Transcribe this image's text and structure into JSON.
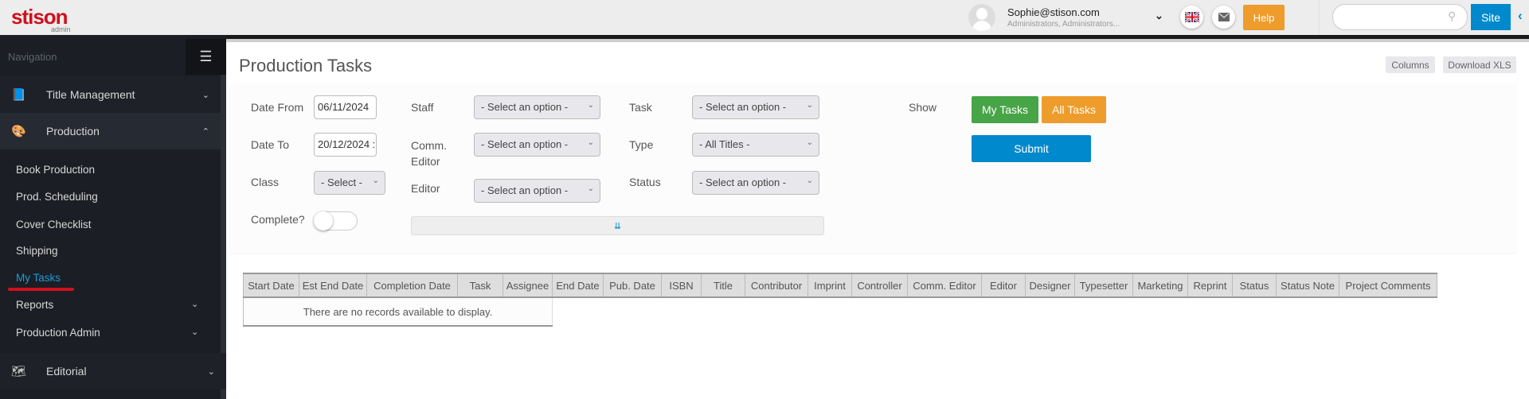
{
  "brand": {
    "logo": "stison",
    "sub": "admin",
    "color": "#d0101e"
  },
  "topbar": {
    "user_email": "Sophie@stison.com",
    "user_roles": "Administrators, Administrators...",
    "help": "Help",
    "search_placeholder": "",
    "site": "Site"
  },
  "sidebar": {
    "heading": "Navigation",
    "sections": [
      {
        "label": "Title Management",
        "icon": "book-icon"
      },
      {
        "label": "Production",
        "icon": "palette-icon"
      },
      {
        "label": "Editorial",
        "icon": "map-icon"
      }
    ],
    "production_items": [
      "Book Production",
      "Prod. Scheduling",
      "Cover Checklist",
      "Shipping",
      "My Tasks"
    ],
    "active": "My Tasks",
    "production_groups": [
      "Reports",
      "Production Admin"
    ]
  },
  "page": {
    "title": "Production Tasks",
    "columns_btn": "Columns",
    "download_btn": "Download XLS"
  },
  "filters": {
    "date_from_label": "Date From",
    "date_from": "06/11/2024",
    "date_to_label": "Date To",
    "date_to": "20/12/2024 :",
    "class_label": "Class",
    "class_value": "- Select -",
    "complete_label": "Complete?",
    "complete": false,
    "staff_label": "Staff",
    "staff_value": "- Select an option -",
    "comm_editor_label": "Comm. Editor",
    "comm_editor_value": "- Select an option -",
    "editor_label": "Editor",
    "editor_value": "- Select an option -",
    "task_label": "Task",
    "task_value": "- Select an option -",
    "type_label": "Type",
    "type_value": "- All Titles -",
    "status_label": "Status",
    "status_value": "- Select an option -",
    "show_label": "Show",
    "my_tasks": "My Tasks",
    "all_tasks": "All Tasks",
    "submit": "Submit"
  },
  "colors": {
    "green": "#47a447",
    "orange": "#ee9c2b",
    "blue": "#0089cc",
    "active_link": "#1e9ad6",
    "underline": "#d0101e"
  },
  "table": {
    "columns": [
      "Start Date",
      "Est End Date",
      "Completion Date",
      "Task",
      "Assignee",
      "End Date",
      "Pub. Date",
      "ISBN",
      "Title",
      "Contributor",
      "Imprint",
      "Controller",
      "Comm. Editor",
      "Editor",
      "Designer",
      "Typesetter",
      "Marketing",
      "Reprint",
      "Status",
      "Status Note",
      "Project Comments"
    ],
    "empty": "There are no records available to display."
  }
}
